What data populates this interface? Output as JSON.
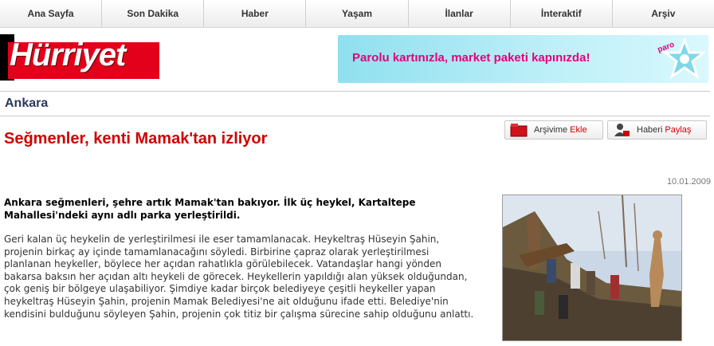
{
  "nav": {
    "items": [
      {
        "label": "Ana Sayfa"
      },
      {
        "label": "Son Dakika"
      },
      {
        "label": "Haber"
      },
      {
        "label": "Yaşam"
      },
      {
        "label": "İlanlar"
      },
      {
        "label": "İnteraktif"
      },
      {
        "label": "Arşiv"
      }
    ]
  },
  "logo": {
    "text": "Hürriyet"
  },
  "banner": {
    "text": "Parolu kartınızla, market paketi kapınızda!",
    "badge": "paro"
  },
  "section": {
    "title": "Ankara"
  },
  "article": {
    "headline": "Seğmenler, kenti Mamak'tan izliyor",
    "date": "10.01.2009",
    "lead": "Ankara seğmenleri, şehre artık Mamak'tan bakıyor. İlk üç heykel, Kartaltepe Mahallesi'ndeki aynı adlı parka yerleştirildi.",
    "body": "Geri kalan üç heykelin de yerleştirilmesi ile eser tamamlanacak. Heykeltraş Hüseyin Şahin, projenin birkaç ay içinde tamamlanacağını söyledi. Birbirine çapraz olarak yerleştirilmesi planlanan heykeller, böylece her açıdan rahatlıkla görülebilecek. Vatandaşlar hangi yönden bakarsa baksın her açıdan altı heykeli de görecek. Heykellerin yapıldığı alan yüksek olduğundan, çok geniş bir bölgeye ulaşabiliyor. Şimdiye kadar birçok belediyeye çeşitli heykeller yapan heykeltraş Hüseyin Şahin, projenin Mamak Belediyesi'ne ait olduğunu ifade etti. Belediye'nin kendisini bulduğunu söyleyen Şahin, projenin çok titiz bir çalışma sürecine sahip olduğunu anlattı."
  },
  "actions": {
    "archive": {
      "label": "Arşivime",
      "action": "Ekle"
    },
    "share": {
      "label": "Haberi",
      "action": "Paylaş"
    }
  },
  "colors": {
    "brand_red": "#e2001a",
    "headline_red": "#d00000",
    "section_navy": "#2a3a5c",
    "banner_pink": "#e4007e"
  }
}
